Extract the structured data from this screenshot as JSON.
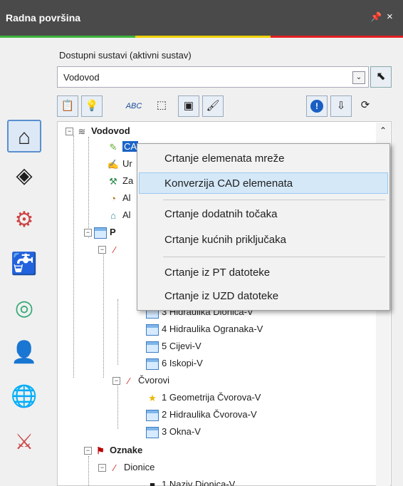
{
  "window": {
    "title": "Radna površina",
    "pin_glyph": "t̷",
    "close_glyph": "×"
  },
  "colors": {
    "titlebar_bg": "#4a4a4a",
    "stripe_green": "#3cb43c",
    "stripe_yellow": "#f0d000",
    "stripe_red": "#e02020",
    "highlight": "#d4e8f8"
  },
  "systems": {
    "label": "Dostupni sustavi (aktivni sustav)",
    "selected": "Vodovod"
  },
  "tree": {
    "root": "Vodovod",
    "items": [
      "CA",
      "Ur",
      "Za",
      "Al",
      "Al",
      "P",
      "3 Hidraulika Dionica-V",
      "4 Hidraulika Ogranaka-V",
      "5 Cijevi-V",
      "6 Iskopi-V",
      "Čvorovi",
      "1 Geometrija Čvorova-V",
      "2 Hidraulika Čvorova-V",
      "3 Okna-V",
      "Oznake",
      "Dionice",
      "1 Naziv Dionica-V"
    ]
  },
  "context_menu": {
    "items": [
      "Crtanje elemenata mreže",
      "Konverzija CAD elemenata",
      "Crtanje dodatnih točaka",
      "Crtanje kućnih priključaka",
      "Crtanje iz PT datoteke",
      "Crtanje iz UZD datoteke"
    ],
    "highlighted_index": 1
  },
  "toolbar_icons": [
    "properties-icon",
    "lightbulb-icon",
    "label-abc-icon",
    "select-icon",
    "window-icon",
    "brush-icon",
    "info-icon",
    "download-icon",
    "refresh-icon"
  ],
  "rail_icons": [
    "home-icon",
    "grid-icon",
    "valve-icon",
    "tap-icon",
    "network-icon",
    "users-icon",
    "globe-icon",
    "routing-icon"
  ]
}
